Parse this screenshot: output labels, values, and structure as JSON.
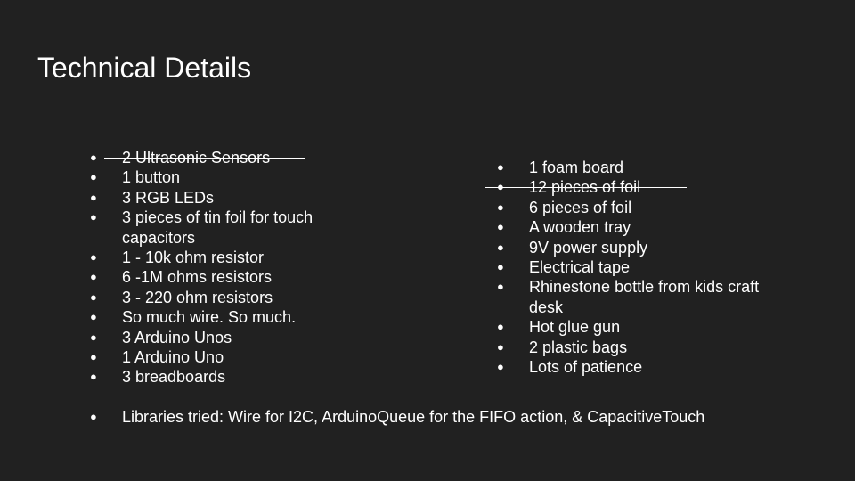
{
  "slide": {
    "title": "Technical Details",
    "left_items": [
      {
        "text": "2 Ultrasonic Sensors",
        "struck": true
      },
      {
        "text": "1 button",
        "struck": false
      },
      {
        "text": "3 RGB LEDs",
        "struck": false
      },
      {
        "text": "3 pieces of tin foil for touch capacitors",
        "struck": false
      },
      {
        "text": "1 - 10k ohm resistor",
        "struck": false
      },
      {
        "text": "6 -1M ohms resistors",
        "struck": false
      },
      {
        "text": "3 - 220 ohm resistors",
        "struck": false
      },
      {
        "text": "So much wire. So much.",
        "struck": false
      },
      {
        "text": "3 Arduino Unos",
        "struck": true
      },
      {
        "text": "1 Arduino Uno",
        "struck": false
      },
      {
        "text": "3 breadboards",
        "struck": false
      }
    ],
    "right_items": [
      {
        "text": "1 foam board",
        "struck": false
      },
      {
        "text": "12 pieces of foil",
        "struck": true
      },
      {
        "text": "6 pieces of foil",
        "struck": false
      },
      {
        "text": "A wooden tray",
        "struck": false
      },
      {
        "text": "9V power supply",
        "struck": false
      },
      {
        "text": "Electrical tape",
        "struck": false
      },
      {
        "text": "Rhinestone bottle from kids craft desk",
        "struck": false
      },
      {
        "text": "Hot glue gun",
        "struck": false
      },
      {
        "text": "2 plastic bags",
        "struck": false
      },
      {
        "text": "Lots of patience",
        "struck": false
      }
    ],
    "bottom_items": [
      {
        "text": "Libraries tried: Wire for I2C, ArduinoQueue for the FIFO action, & CapacitiveTouch",
        "struck": false
      }
    ],
    "bullet_glyph": "●",
    "colors": {
      "background": "#212121",
      "text": "#ffffff"
    }
  }
}
